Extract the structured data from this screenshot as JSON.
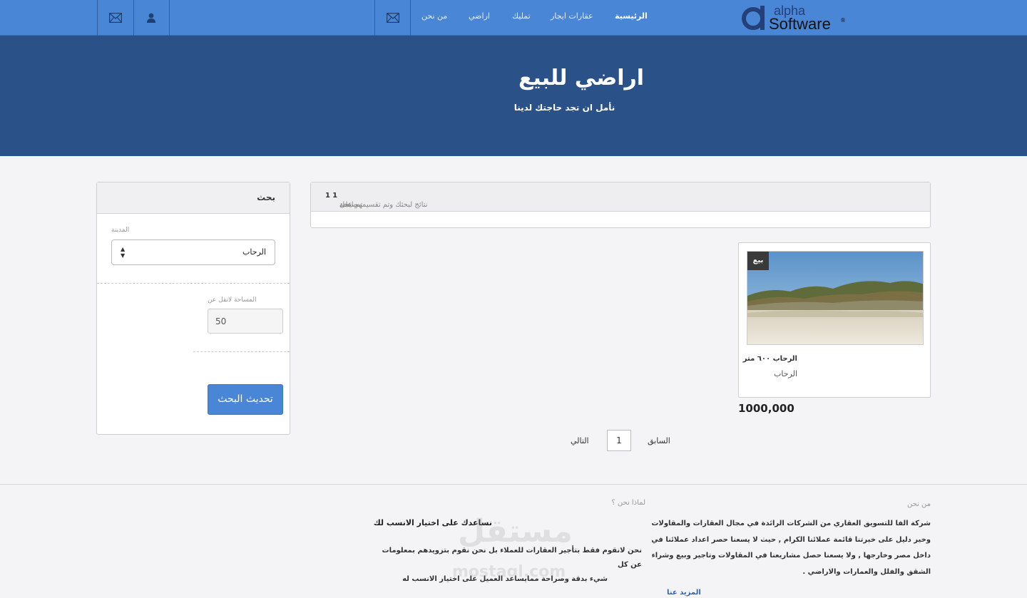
{
  "nav": {
    "brand_top": "alpha",
    "brand_bottom": "Software",
    "brand_mark": "®",
    "links": [
      {
        "label": "الرئيسية",
        "active": true
      },
      {
        "label": "عقارات ايجار",
        "active": false
      },
      {
        "label": "تمليك",
        "active": false
      },
      {
        "label": "اراضي",
        "active": false
      },
      {
        "label": "من نحن",
        "active": false
      }
    ],
    "icons": [
      "mail-icon",
      "user-icon",
      "mail-icon"
    ]
  },
  "hero": {
    "title": "اراضي للبيع",
    "subtitle": "نأمل ان تجد حاجتك لدينا"
  },
  "search": {
    "heading": "بحث",
    "city_label": "المدينة",
    "city_value": "الرحاب",
    "area_label": "المساحة لاتقل عن",
    "area_value": "50",
    "submit_label": "تحديث البحث"
  },
  "results": {
    "prefix": "تم ايجاد",
    "count": "1",
    "middle": "نتائج لبحثك وتم تقسيمهم على",
    "pages": "1",
    "suffix": "صفحة"
  },
  "listing": {
    "badge": "بيع",
    "title": "الرحاب ٦٠٠ متر",
    "location": "الرحاب",
    "price": "1000,000"
  },
  "pagination": {
    "prev": "السابق",
    "page": "1",
    "next": "التالي"
  },
  "footer": {
    "about_heading": "من نحن",
    "about_lines": [
      "شركة  الفا للتسويق العقاري من الشركات الرائدة في مجال العقارات والمقاولات",
      "وخير دليل على خبرتنا قائمة عملائنا الكرام , حيث لا يسعنا حصر اعداد عملائنا في",
      "داخل مصر وخارجها , ولا يسعنا حصل مشاريعنا في المقاولات  وتاجير وبيع وشراء",
      "الشقق والفلل والعمارات والاراضي  ."
    ],
    "more_link": "المزيد عنا",
    "why_heading": "لماذا نحن ؟",
    "why_title": "نساعدك على اختيار الانسب لك",
    "why_lines": [
      "نحن لانقوم فقط بتأجير العقارات للعملاء بل نحن نقوم بتزويدهم بمعلومات عن كل",
      "شيء بدقة وصراحة ممايساعد العميل على اختيار الانسب له"
    ],
    "watermark_top": "مستقل",
    "watermark_bottom": "mostaql.com"
  },
  "colors": {
    "navbar": "#4a86d6",
    "hero": "#2a5188",
    "button": "#4a86d6",
    "link": "#2f64b8"
  }
}
